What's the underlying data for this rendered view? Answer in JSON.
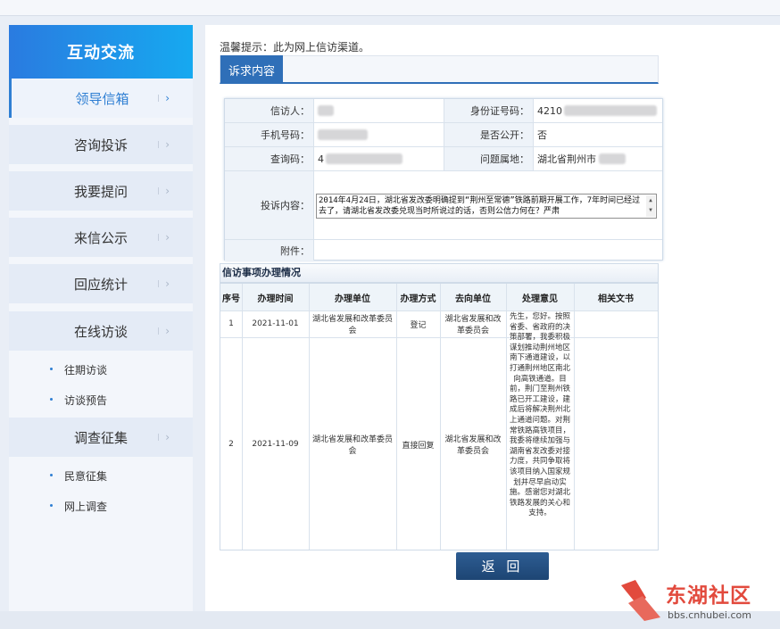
{
  "sidebar": {
    "title": "互动交流",
    "items": [
      {
        "label": "领导信箱"
      },
      {
        "label": "咨询投诉"
      },
      {
        "label": "我要提问"
      },
      {
        "label": "来信公示"
      },
      {
        "label": "回应统计"
      },
      {
        "label": "在线访谈"
      },
      {
        "label": "调查征集"
      }
    ],
    "sub_interview": [
      "往期访谈",
      "访谈预告"
    ],
    "sub_survey": [
      "民意征集",
      "网上调查"
    ],
    "chevron": "›"
  },
  "main": {
    "hint": "温馨提示：此为网上信访渠道。",
    "tab_label": "诉求内容",
    "form": {
      "sender_label": "信访人：",
      "id_label": "身份证号码：",
      "id_value": "4210",
      "phone_label": "手机号码：",
      "public_label": "是否公开：",
      "public_value": "否",
      "query_label": "查询码：",
      "query_value": "4",
      "location_label": "问题属地：",
      "location_value": "湖北省荆州市",
      "complaint_label": "投诉内容：",
      "complaint_text": "2014年4月24日，湖北省发改委明确提到“荆州至常德”铁路前期开展工作，7年时间已经过去了，请湖北省发改委兑现当时所说过的话，否则公信力何在？严肃",
      "attachment_label": "附件："
    },
    "section_title": "信访事项办理情况",
    "table": {
      "headers": [
        "序号",
        "办理时间",
        "办理单位",
        "办理方式",
        "去向单位",
        "处理意见",
        "相关文书"
      ],
      "rows": [
        {
          "no": "1",
          "time": "2021-11-01",
          "unit": "湖北省发展和改革委员会",
          "method": "登记",
          "dest": "湖北省发展和改革委员会",
          "opinion": "",
          "docs": ""
        },
        {
          "no": "2",
          "time": "2021-11-09",
          "unit": "湖北省发展和改革委员会",
          "method": "直接回复",
          "dest": "湖北省发展和改革委员会",
          "opinion": "先生，您好。按照省委、省政府的决策部署，我委积极谋划推动荆州地区南下通道建设，以打通荆州地区南北向高铁通道。目前，荆门至荆州铁路已开工建设，建成后将解决荆州北上通道问题。对荆常铁路高铁项目，我委将继续加强与湖南省发改委对接力度，共同争取将该项目纳入国家规划并尽早启动实施。感谢您对湖北铁路发展的关心和支持。",
          "docs": ""
        }
      ]
    },
    "back_label": "返 回"
  },
  "watermark": {
    "title": "东湖社区",
    "url": "bbs.cnhubei.com"
  }
}
